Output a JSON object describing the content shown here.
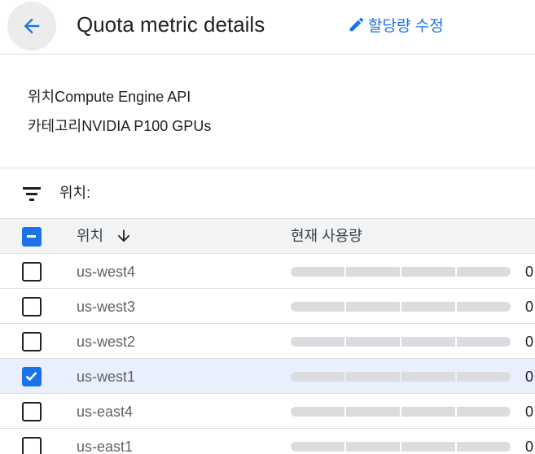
{
  "header": {
    "back_icon": "arrow-back-icon",
    "title": "Quota metric details",
    "edit_icon": "pencil-icon",
    "edit_label": "할당량 수정",
    "accent_color": "#1a73e8"
  },
  "details": {
    "service_label": "위치",
    "service_value": "Compute Engine API",
    "category_label": "카테고리",
    "category_value": "NVIDIA P100 GPUs"
  },
  "filter": {
    "icon": "filter-icon",
    "label": "위치:"
  },
  "table": {
    "columns": {
      "location": "위치",
      "location_sort_icon": "arrow-down-icon",
      "usage": "현재 사용량"
    },
    "select_all_state": "indeterminate",
    "rows": [
      {
        "location": "us-west4",
        "usage": "0",
        "checked": false
      },
      {
        "location": "us-west3",
        "usage": "0",
        "checked": false
      },
      {
        "location": "us-west2",
        "usage": "0",
        "checked": false
      },
      {
        "location": "us-west1",
        "usage": "0",
        "checked": true
      },
      {
        "location": "us-east4",
        "usage": "0",
        "checked": false
      },
      {
        "location": "us-east1",
        "usage": "0",
        "checked": false
      }
    ]
  }
}
